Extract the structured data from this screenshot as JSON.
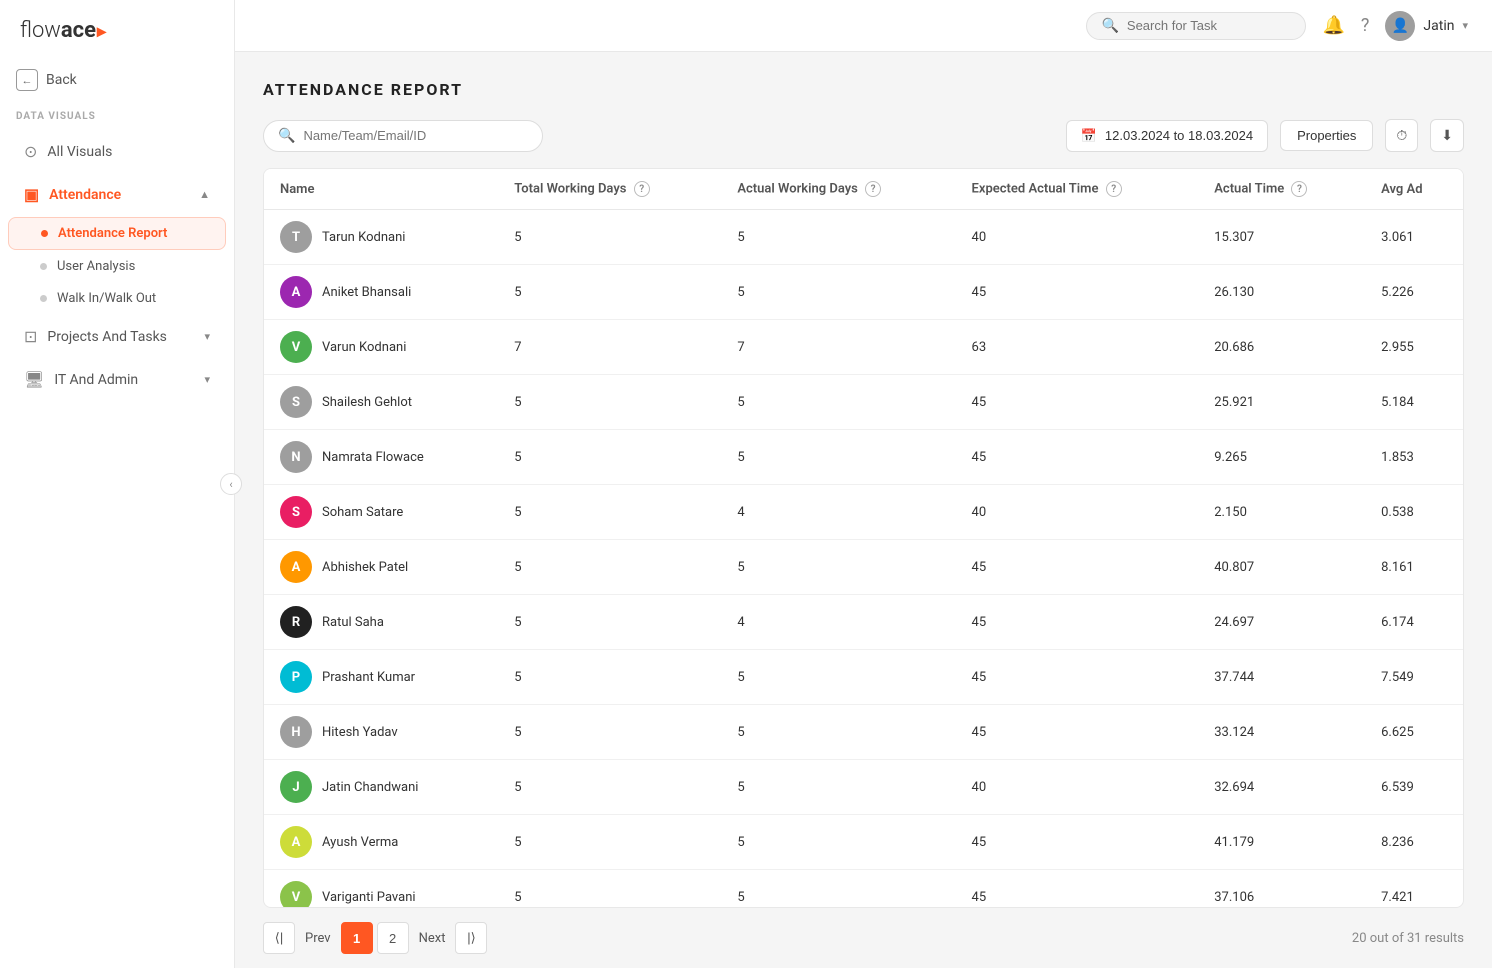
{
  "app": {
    "name_plain": "flow",
    "name_bold": "ace",
    "logo_accent": "▸"
  },
  "topbar": {
    "search_placeholder": "Search for Task",
    "user_name": "Jatin"
  },
  "back_button": "Back",
  "sidebar": {
    "section_label": "DATA VISUALS",
    "nav_items": [
      {
        "id": "all-visuals",
        "label": "All Visuals",
        "icon": "⊙"
      },
      {
        "id": "attendance",
        "label": "Attendance",
        "icon": "◫",
        "active": true,
        "expanded": true,
        "sub_items": [
          {
            "id": "attendance-report",
            "label": "Attendance Report",
            "active": true
          },
          {
            "id": "user-analysis",
            "label": "User Analysis"
          },
          {
            "id": "walk-in-out",
            "label": "Walk In/Walk Out"
          }
        ]
      },
      {
        "id": "projects-tasks",
        "label": "Projects And Tasks",
        "icon": "⊡",
        "has_arrow": true
      },
      {
        "id": "it-admin",
        "label": "IT And Admin",
        "icon": "⬕",
        "has_arrow": true
      }
    ]
  },
  "page": {
    "title": "ATTENDANCE REPORT",
    "search_placeholder": "Name/Team/Email/ID",
    "date_range": "12.03.2024 to 18.03.2024",
    "properties_btn": "Properties",
    "columns": [
      {
        "id": "name",
        "label": "Name",
        "help": false
      },
      {
        "id": "total_working_days",
        "label": "Total Working Days",
        "help": true
      },
      {
        "id": "actual_working_days",
        "label": "Actual Working Days",
        "help": true
      },
      {
        "id": "expected_actual_time",
        "label": "Expected Actual Time",
        "help": true
      },
      {
        "id": "actual_time",
        "label": "Actual Time",
        "help": true
      },
      {
        "id": "avg_ad",
        "label": "Avg Ad",
        "help": false
      }
    ],
    "rows": [
      {
        "name": "Tarun Kodnani",
        "avatar_color": "#9e9e9e",
        "avatar_initials": "T",
        "has_img": true,
        "total_working_days": 5,
        "actual_working_days": 5,
        "expected_actual_time": 40,
        "actual_time": "15.307",
        "avg_ad": "3.061"
      },
      {
        "name": "Aniket Bhansali",
        "avatar_color": "#9c27b0",
        "avatar_initials": "A",
        "has_img": false,
        "total_working_days": 5,
        "actual_working_days": 5,
        "expected_actual_time": 45,
        "actual_time": "26.130",
        "avg_ad": "5.226"
      },
      {
        "name": "Varun Kodnani",
        "avatar_color": "#4caf50",
        "avatar_initials": "V",
        "has_img": false,
        "total_working_days": 7,
        "actual_working_days": 7,
        "expected_actual_time": 63,
        "actual_time": "20.686",
        "avg_ad": "2.955"
      },
      {
        "name": "Shailesh Gehlot",
        "avatar_color": "#9e9e9e",
        "avatar_initials": "S",
        "has_img": true,
        "total_working_days": 5,
        "actual_working_days": 5,
        "expected_actual_time": 45,
        "actual_time": "25.921",
        "avg_ad": "5.184"
      },
      {
        "name": "Namrata Flowace",
        "avatar_color": "#9e9e9e",
        "avatar_initials": "N",
        "has_img": true,
        "total_working_days": 5,
        "actual_working_days": 5,
        "expected_actual_time": 45,
        "actual_time": "9.265",
        "avg_ad": "1.853"
      },
      {
        "name": "Soham Satare",
        "avatar_color": "#e91e63",
        "avatar_initials": "S",
        "has_img": false,
        "total_working_days": 5,
        "actual_working_days": 4,
        "expected_actual_time": 40,
        "actual_time": "2.150",
        "avg_ad": "0.538"
      },
      {
        "name": "Abhishek Patel",
        "avatar_color": "#ff9800",
        "avatar_initials": "A",
        "has_img": false,
        "total_working_days": 5,
        "actual_working_days": 5,
        "expected_actual_time": 45,
        "actual_time": "40.807",
        "avg_ad": "8.161"
      },
      {
        "name": "Ratul Saha",
        "avatar_color": "#212121",
        "avatar_initials": "R",
        "has_img": false,
        "total_working_days": 5,
        "actual_working_days": 4,
        "expected_actual_time": 45,
        "actual_time": "24.697",
        "avg_ad": "6.174"
      },
      {
        "name": "Prashant Kumar",
        "avatar_color": "#00bcd4",
        "avatar_initials": "P",
        "has_img": false,
        "total_working_days": 5,
        "actual_working_days": 5,
        "expected_actual_time": 45,
        "actual_time": "37.744",
        "avg_ad": "7.549"
      },
      {
        "name": "Hitesh Yadav",
        "avatar_color": "#9e9e9e",
        "avatar_initials": "H",
        "has_img": true,
        "total_working_days": 5,
        "actual_working_days": 5,
        "expected_actual_time": 45,
        "actual_time": "33.124",
        "avg_ad": "6.625"
      },
      {
        "name": "Jatin Chandwani",
        "avatar_color": "#4caf50",
        "avatar_initials": "J",
        "has_img": false,
        "total_working_days": 5,
        "actual_working_days": 5,
        "expected_actual_time": 40,
        "actual_time": "32.694",
        "avg_ad": "6.539"
      },
      {
        "name": "Ayush Verma",
        "avatar_color": "#cddc39",
        "avatar_initials": "A",
        "has_img": false,
        "total_working_days": 5,
        "actual_working_days": 5,
        "expected_actual_time": 45,
        "actual_time": "41.179",
        "avg_ad": "8.236"
      },
      {
        "name": "Variganti Pavani",
        "avatar_color": "#8bc34a",
        "avatar_initials": "V",
        "has_img": false,
        "total_working_days": 5,
        "actual_working_days": 5,
        "expected_actual_time": 45,
        "actual_time": "37.106",
        "avg_ad": "7.421"
      }
    ]
  },
  "pagination": {
    "prev_label": "Prev",
    "next_label": "Next",
    "current_page": 1,
    "total_pages": 2,
    "page_info": "20 out of 31 results"
  }
}
